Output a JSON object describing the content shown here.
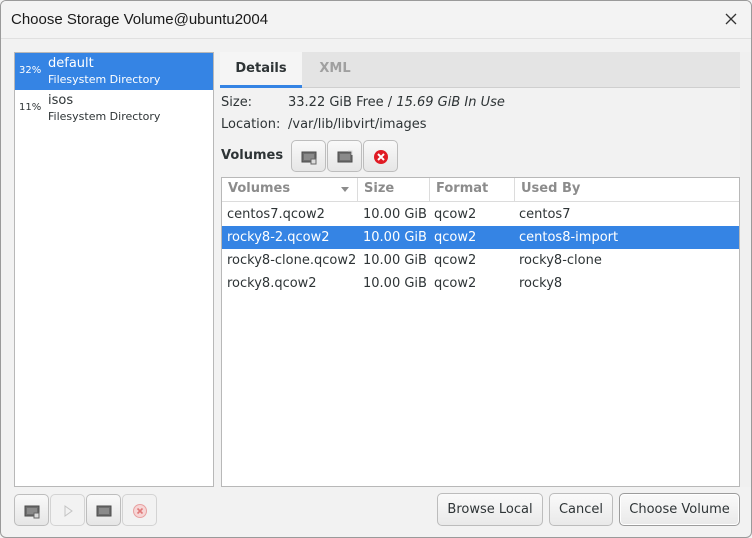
{
  "window": {
    "title": "Choose Storage Volume@ubuntu2004"
  },
  "pools": [
    {
      "percent": "32%",
      "name": "default",
      "type": "Filesystem Directory",
      "selected": true
    },
    {
      "percent": "11%",
      "name": "isos",
      "type": "Filesystem Directory",
      "selected": false
    }
  ],
  "tabs": [
    {
      "label": "Details",
      "active": true
    },
    {
      "label": "XML",
      "active": false
    }
  ],
  "details": {
    "size_label": "Size:",
    "size_free": "33.22 GiB Free / ",
    "size_in_use": "15.69 GiB In Use",
    "location_label": "Location:",
    "location_value": "/var/lib/libvirt/images",
    "volumes_label": "Volumes"
  },
  "volume_table": {
    "columns": [
      "Volumes",
      "Size",
      "Format",
      "Used By"
    ],
    "rows": [
      {
        "name": "centos7.qcow2",
        "size": "10.00 GiB",
        "format": "qcow2",
        "used_by": "centos7",
        "selected": false
      },
      {
        "name": "rocky8-2.qcow2",
        "size": "10.00 GiB",
        "format": "qcow2",
        "used_by": "centos8-import",
        "selected": true
      },
      {
        "name": "rocky8-clone.qcow2",
        "size": "10.00 GiB",
        "format": "qcow2",
        "used_by": "rocky8-clone",
        "selected": false
      },
      {
        "name": "rocky8.qcow2",
        "size": "10.00 GiB",
        "format": "qcow2",
        "used_by": "rocky8",
        "selected": false
      }
    ]
  },
  "buttons": {
    "browse_local": "Browse Local",
    "cancel": "Cancel",
    "choose_volume": "Choose Volume"
  },
  "icons": {
    "close": "close-icon",
    "new_volume": "new-volume-icon",
    "refresh_volumes": "refresh-icon",
    "delete_volume": "delete-icon",
    "add_pool": "add-pool-icon",
    "start_pool": "play-icon",
    "stop_pool": "stop-pool-icon",
    "delete_pool": "delete-icon"
  },
  "colors": {
    "selection": "#3584e4",
    "delete": "#e01b24"
  }
}
